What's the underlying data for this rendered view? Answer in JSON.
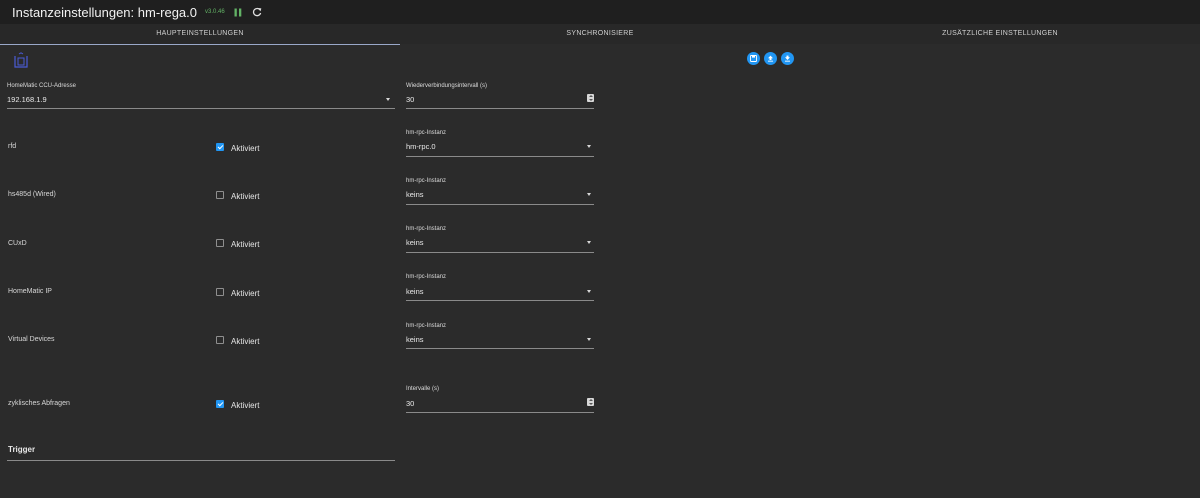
{
  "header": {
    "title": "Instanzeinstellungen: hm-rega.0",
    "version": "v3.0.46"
  },
  "tabs": [
    {
      "label": "HAUPTEINSTELLUNGEN"
    },
    {
      "label": "SYNCHRONISIERE"
    },
    {
      "label": "ZUSÄTZLICHE EINSTELLUNGEN"
    }
  ],
  "ccu": {
    "label": "HomeMatic CCU-Adresse",
    "value": "192.168.1.9"
  },
  "reconnect": {
    "label": "Wiederverbindungsintervall (s)",
    "value": "30"
  },
  "checkbox_text": "Aktiviert",
  "rows": [
    {
      "label": "rfd",
      "checked": true,
      "rpc_label": "hm-rpc-Instanz",
      "rpc_value": "hm-rpc.0"
    },
    {
      "label": "hs485d (Wired)",
      "checked": false,
      "rpc_label": "hm-rpc-Instanz",
      "rpc_value": "keins"
    },
    {
      "label": "CUxD",
      "checked": false,
      "rpc_label": "hm-rpc-Instanz",
      "rpc_value": "keins"
    },
    {
      "label": "HomeMatic IP",
      "checked": false,
      "rpc_label": "hm-rpc-Instanz",
      "rpc_value": "keins"
    },
    {
      "label": "Virtual Devices",
      "checked": false,
      "rpc_label": "hm-rpc-Instanz",
      "rpc_value": "keins"
    }
  ],
  "polling": {
    "label": "zyklisches Abfragen",
    "checked": true,
    "interval_label": "Intervalle (s)",
    "interval_value": "30"
  },
  "trigger": {
    "title": "Trigger"
  },
  "colors": {
    "accent": "#2196f3",
    "background": "#2b2b2b",
    "header": "#1f1f1f",
    "version": "#63b366"
  }
}
